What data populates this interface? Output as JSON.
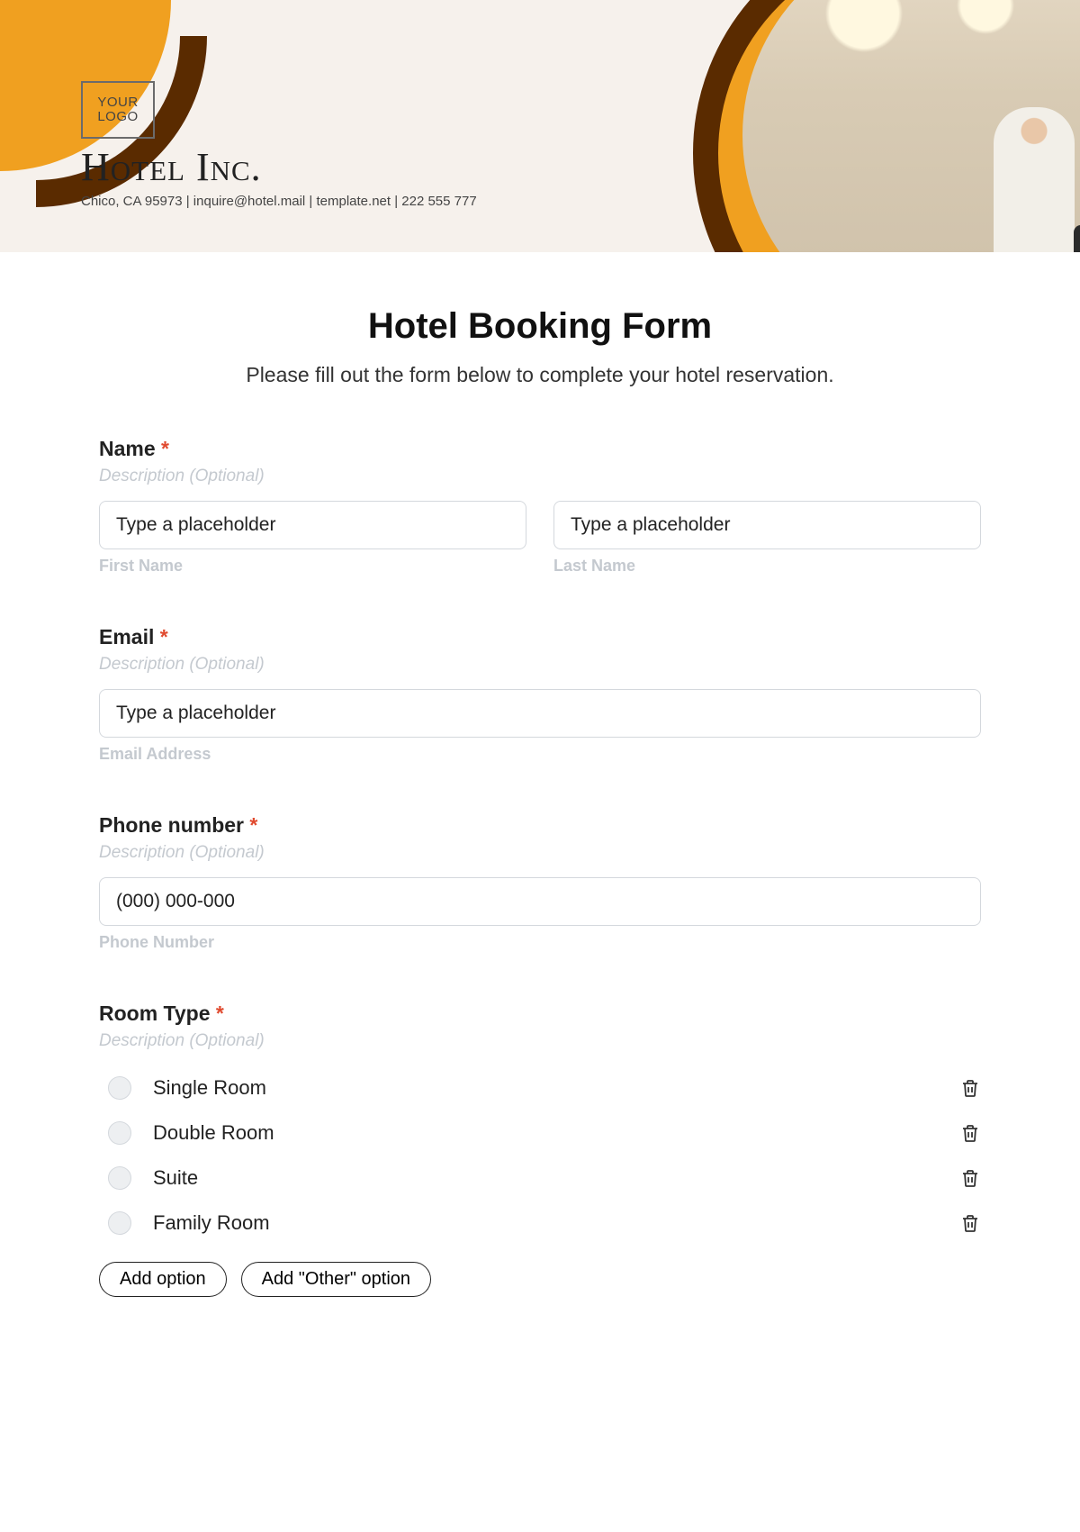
{
  "header": {
    "logo_text": "YOUR LOGO",
    "company": "Hotel Inc.",
    "contact": "Chico, CA 95973 | inquire@hotel.mail | template.net | 222 555 777"
  },
  "form": {
    "title": "Hotel Booking Form",
    "subtitle": "Please fill out the form below to complete your hotel reservation.",
    "name": {
      "label": "Name",
      "required": "*",
      "description": "Description (Optional)",
      "first_placeholder": "Type a placeholder",
      "first_sub": "First Name",
      "last_placeholder": "Type a placeholder",
      "last_sub": "Last Name"
    },
    "email": {
      "label": "Email",
      "required": "*",
      "description": "Description (Optional)",
      "placeholder": "Type a placeholder",
      "sub": "Email Address"
    },
    "phone": {
      "label": "Phone number",
      "required": "*",
      "description": "Description (Optional)",
      "placeholder": "(000) 000-000",
      "sub": "Phone Number"
    },
    "room": {
      "label": "Room Type",
      "required": "*",
      "description": "Description (Optional)",
      "options": [
        "Single Room",
        "Double Room",
        "Suite",
        "Family Room"
      ],
      "add_option": "Add option",
      "add_other": "Add \"Other\" option"
    }
  }
}
